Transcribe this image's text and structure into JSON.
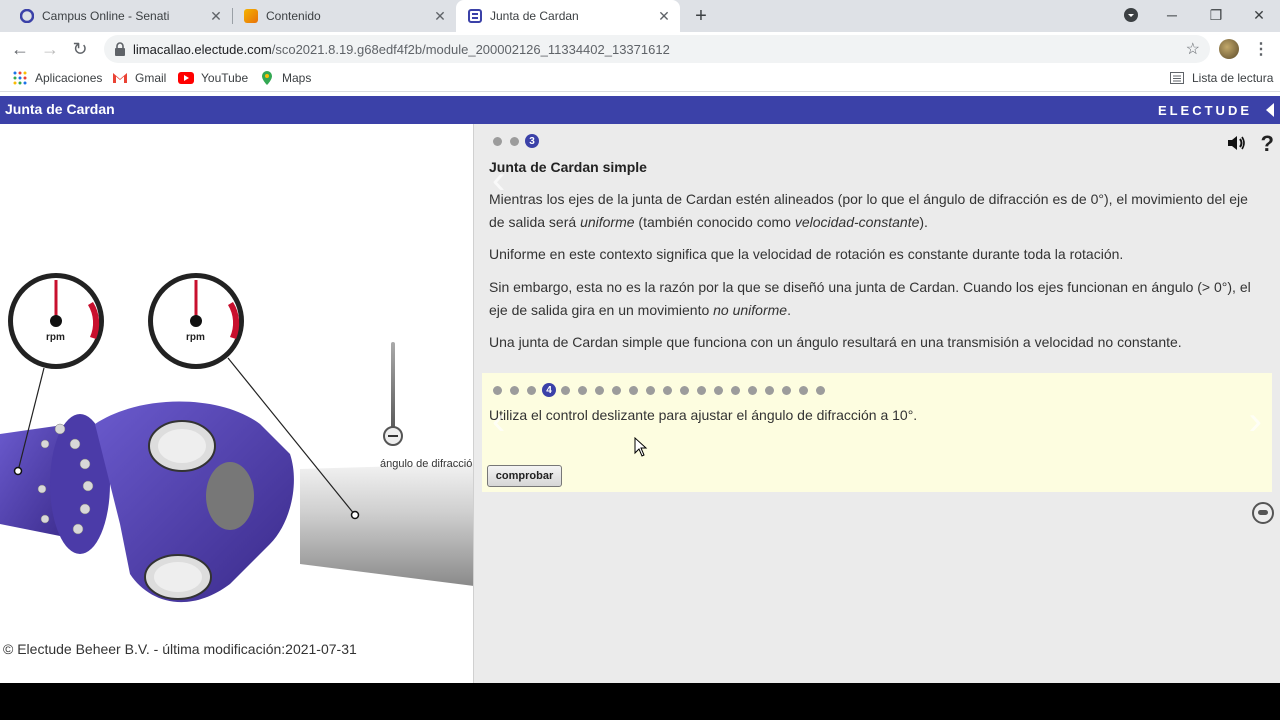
{
  "browser": {
    "tabs": [
      {
        "title": "Campus Online - Senati",
        "active": false
      },
      {
        "title": "Contenido",
        "active": false
      },
      {
        "title": "Junta de Cardan",
        "active": true
      }
    ],
    "url_host": "limacallao.electude.com",
    "url_path": "/sco2021.8.19.g68edf4f2b/module_200002126_11334402_13371612",
    "bookmarks": [
      "Aplicaciones",
      "Gmail",
      "YouTube",
      "Maps"
    ],
    "reading_list": "Lista de lectura"
  },
  "app": {
    "title": "Junta de Cardan",
    "brand": "ELECTUDE",
    "accent": "#3b41a8"
  },
  "left": {
    "gauge_label_1": "rpm",
    "gauge_label_2": "rpm",
    "slider_label": "ángulo de difracción",
    "copyright": "© Electude Beheer B.V. - última modificación:2021-07-31"
  },
  "content": {
    "page_indicator": "3",
    "title": "Junta de Cardan simple",
    "p1_a": "Mientras los ejes de la junta de Cardan estén alineados (por lo que el ángulo de difracción es de 0°), el movimiento del eje de salida será ",
    "p1_em1": "uniforme",
    "p1_b": " (también conocido como ",
    "p1_em2": "velocidad-constante",
    "p1_c": ").",
    "p2": "Uniforme en este contexto significa que la velocidad de rotación es constante durante toda la rotación.",
    "p3_a": "Sin embargo, esta no es la razón por la que se diseñó una junta de Cardan. Cuando los ejes funcionan en ángulo (> 0°), el eje de salida gira en un movimiento ",
    "p3_em": "no uniforme",
    "p3_b": ".",
    "p4": "Una junta de Cardan simple que funciona con un ángulo resultará en una transmisión a velocidad no constante.",
    "task": {
      "step_indicator": "4",
      "instruction": "Utiliza el control deslizante para ajustar el ángulo de difracción a 10°.",
      "button": "comprobar"
    }
  }
}
